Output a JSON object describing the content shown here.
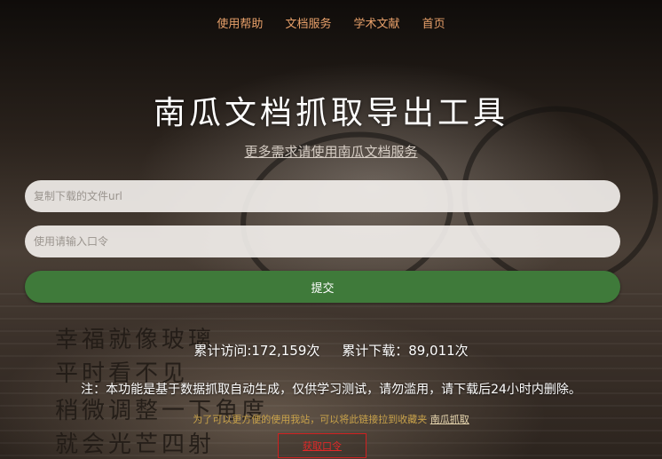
{
  "nav": {
    "items": [
      "使用帮助",
      "文档服务",
      "学术文献",
      "首页"
    ]
  },
  "header": {
    "title": "南瓜文档抓取导出工具",
    "subtitle_link": "更多需求请使用南瓜文档服务"
  },
  "form": {
    "url_placeholder": "复制下载的文件url",
    "code_placeholder": "使用请输入口令",
    "submit_label": "提交"
  },
  "background_text": {
    "line1": "幸福就像玻璃",
    "line2": "平时看不见",
    "line3": "稍微调整一下角度",
    "line4": "就会光芒四射"
  },
  "stats": {
    "visits": "累计访问:172,159次",
    "downloads": "累计下载：89,011次"
  },
  "notice": "注：本功能是基于数据抓取自动生成，仅供学习测试，请勿滥用，请下载后24小时内删除。",
  "bookmark": {
    "text": "为了可以更方便的使用我站，可以将此链接拉到收藏夹",
    "link": "南瓜抓取"
  },
  "get_code_label": "获取口令",
  "colors": {
    "nav_link": "#e8a06a",
    "submit_bg": "#3f7a3a",
    "get_code_border": "#d02020"
  }
}
